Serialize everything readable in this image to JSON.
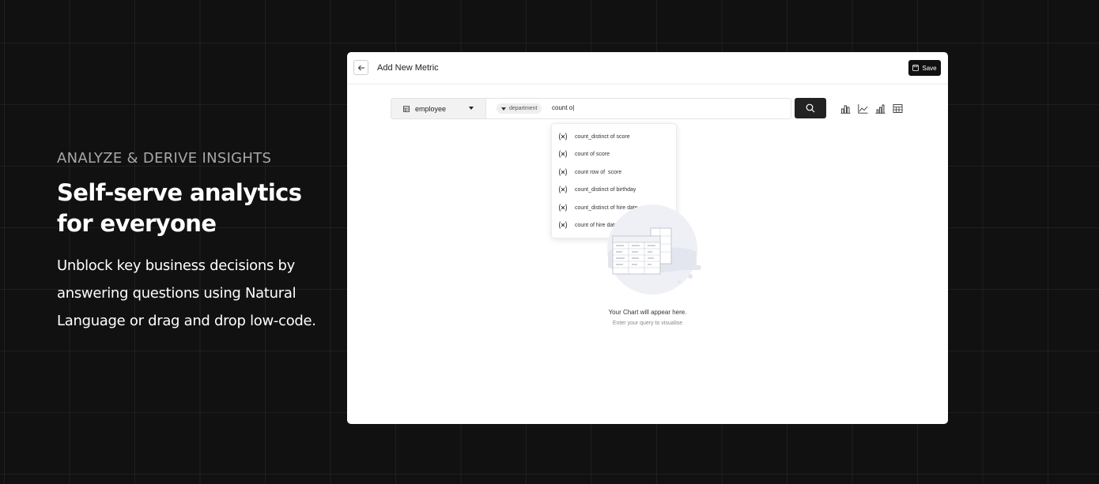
{
  "hero": {
    "eyebrow": "ANALYZE & DERIVE INSIGHTS",
    "headline": "Self-serve analytics for everyone",
    "description": "Unblock key business decisions by answering questions using Natural Language or drag and drop low-code."
  },
  "editor": {
    "title": "Add New Metric",
    "save_label": "Save",
    "table_select": {
      "value": "employee",
      "icon": "table-icon"
    },
    "dimension_chip": "department",
    "query_text": "count o|",
    "chart_types": [
      "bar-chart-icon",
      "line-chart-icon",
      "column-chart-icon",
      "table-view-icon"
    ],
    "suggestions": [
      {
        "label": "count_distinct of score",
        "icon": "function-icon"
      },
      {
        "label": "count of score",
        "icon": "function-icon"
      },
      {
        "label": "count row of  score",
        "icon": "function-icon"
      },
      {
        "label": "count_distinct of birthday",
        "icon": "function-icon"
      },
      {
        "label": "count_distinct of hire date",
        "icon": "function-icon"
      },
      {
        "label": "count of hire date",
        "icon": "function-icon"
      }
    ],
    "empty_state": {
      "title": "Your Chart will appear here.",
      "subtitle": "Enter your query to visualise"
    }
  },
  "colors": {
    "background": "#111111",
    "card": "#ffffff",
    "primary_button": "#111111",
    "muted_text": "#a8a8a8"
  }
}
